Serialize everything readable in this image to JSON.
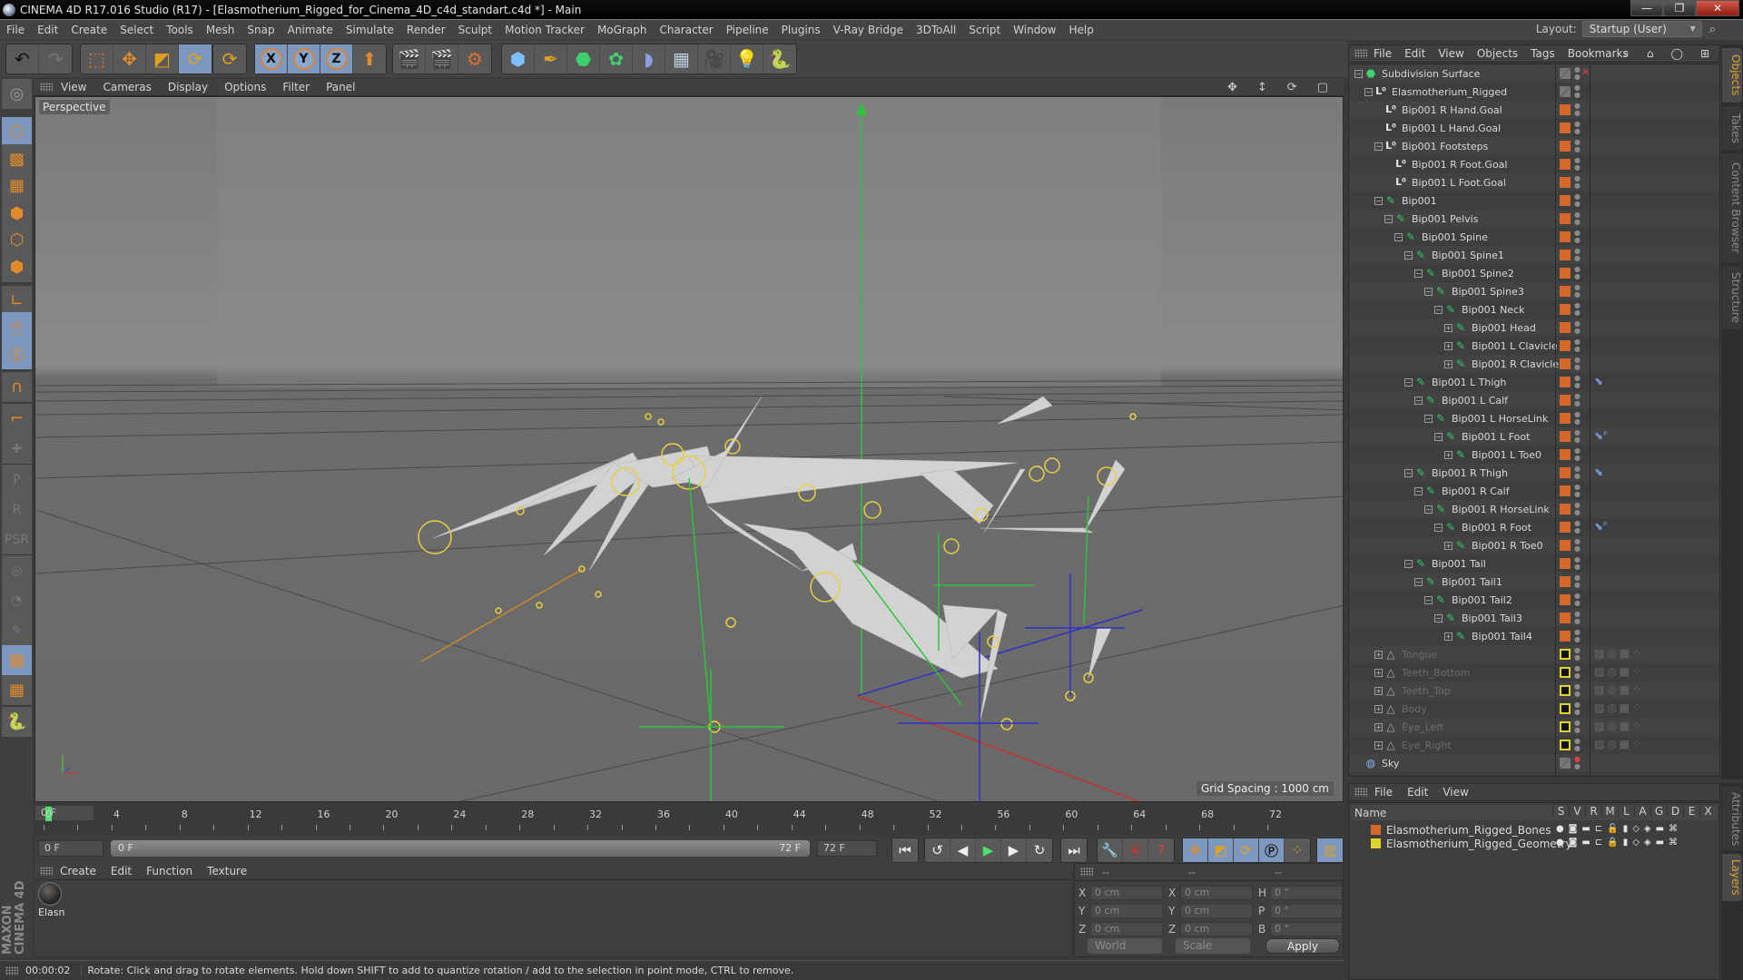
{
  "titlebar": {
    "title": "CINEMA 4D R17.016 Studio (R17) - [Elasmotherium_Rigged_for_Cinema_4D_c4d_standart.c4d *] - Main",
    "buttons": [
      "—",
      "❐",
      "✕"
    ]
  },
  "menubar": {
    "items": [
      "File",
      "Edit",
      "Create",
      "Select",
      "Tools",
      "Mesh",
      "Snap",
      "Animate",
      "Simulate",
      "Render",
      "Sculpt",
      "Motion Tracker",
      "MoGraph",
      "Character",
      "Pipeline",
      "Plugins",
      "V-Ray Bridge",
      "3DToAll",
      "Script",
      "Window",
      "Help"
    ],
    "layout_label": "Layout:",
    "layout_value": "Startup (User)"
  },
  "toolbar": {
    "undo": "↶",
    "redo": "↷",
    "tools": [
      "live-selection",
      "move",
      "scale",
      "rotate",
      "recent-tool"
    ],
    "axes": [
      "X",
      "Y",
      "Z"
    ],
    "coord_system": "world-coordinates",
    "render": [
      "render-view",
      "render-picture-viewer",
      "render-settings"
    ],
    "create": [
      "cube",
      "pen",
      "subdivision",
      "cloner",
      "deformer",
      "floor",
      "camera",
      "light",
      "python"
    ]
  },
  "lefttoolbar": {
    "tools": [
      "make-editable",
      "model-mode",
      "texture-mode",
      "workplane-mode",
      "points-mode",
      "edges-mode",
      "polygons-mode",
      "axis-mode",
      "tweak-mode",
      "solo-mode",
      "snap",
      "workplane-axis",
      "add-joint",
      "pose-p",
      "pose-r",
      "pose-psr",
      "pose-target",
      "pose-camera",
      "pose-edit",
      "lock-workplane",
      "workplane-cycle",
      "python"
    ]
  },
  "viewport": {
    "menu": [
      "View",
      "Cameras",
      "Display",
      "Options",
      "Filter",
      "Panel"
    ],
    "camera_label": "Perspective",
    "grid_spacing": "Grid Spacing : 1000 cm",
    "nav_icons": [
      "✥",
      "↕",
      "⟳",
      "▢"
    ]
  },
  "timeline": {
    "ticks": [
      "0",
      "4",
      "8",
      "12",
      "16",
      "20",
      "24",
      "28",
      "32",
      "36",
      "40",
      "44",
      "48",
      "52",
      "56",
      "60",
      "64",
      "68",
      "72"
    ],
    "current_frame": "0 F",
    "start_field": "0 F",
    "range_start": "0 F",
    "range_end": "72 F",
    "end_field": "72 F"
  },
  "playback": {
    "buttons": [
      "go-to-start",
      "previous-key",
      "previous-frame",
      "play",
      "next-frame",
      "next-key",
      "go-to-end"
    ],
    "glyphs": [
      "⏮",
      "↺",
      "◀",
      "▶",
      "▶",
      "↻",
      "⏭"
    ]
  },
  "materials": {
    "menu": [
      "Create",
      "Edit",
      "Function",
      "Texture"
    ],
    "items": [
      {
        "name": "Elasn"
      }
    ]
  },
  "coordinates": {
    "headers": [
      "--",
      "--",
      "--"
    ],
    "rows": [
      {
        "l1": "X",
        "v1": "0 cm",
        "l2": "X",
        "v2": "0 cm",
        "l3": "H",
        "v3": "0 °"
      },
      {
        "l1": "Y",
        "v1": "0 cm",
        "l2": "Y",
        "v2": "0 cm",
        "l3": "P",
        "v3": "0 °"
      },
      {
        "l1": "Z",
        "v1": "0 cm",
        "l2": "Z",
        "v2": "0 cm",
        "l3": "B",
        "v3": "0 °"
      }
    ],
    "mode": "World",
    "size_mode": "Scale",
    "apply": "Apply"
  },
  "statusbar": {
    "time": "00:00:02",
    "message": "Rotate: Click and drag to rotate elements. Hold down SHIFT to add to quantize rotation / add to the selection in point mode, CTRL to remove."
  },
  "objectmanager": {
    "menu": [
      "File",
      "Edit",
      "View",
      "Objects",
      "Tags",
      "Bookmarks"
    ],
    "objects": [
      {
        "name": "Subdivision Surface",
        "depth": 0,
        "type": "subdiv",
        "exp": "−",
        "layer": "none"
      },
      {
        "name": "Elasmotherium_Rigged",
        "depth": 1,
        "type": "null",
        "exp": "−",
        "layer": "none"
      },
      {
        "name": "Bip001 R Hand.Goal",
        "depth": 2,
        "type": "null",
        "exp": "",
        "layer": "bones"
      },
      {
        "name": "Bip001 L Hand.Goal",
        "depth": 2,
        "type": "null",
        "exp": "",
        "layer": "bones"
      },
      {
        "name": "Bip001 Footsteps",
        "depth": 2,
        "type": "null",
        "exp": "−",
        "layer": "bones"
      },
      {
        "name": "Bip001 R Foot.Goal",
        "depth": 3,
        "type": "null",
        "exp": "",
        "layer": "bones"
      },
      {
        "name": "Bip001 L Foot.Goal",
        "depth": 3,
        "type": "null",
        "exp": "",
        "layer": "bones"
      },
      {
        "name": "Bip001",
        "depth": 2,
        "type": "bone",
        "exp": "−",
        "layer": "bones"
      },
      {
        "name": "Bip001 Pelvis",
        "depth": 3,
        "type": "bone",
        "exp": "−",
        "layer": "bones"
      },
      {
        "name": "Bip001 Spine",
        "depth": 4,
        "type": "bone",
        "exp": "−",
        "layer": "bones"
      },
      {
        "name": "Bip001 Spine1",
        "depth": 5,
        "type": "bone",
        "exp": "−",
        "layer": "bones"
      },
      {
        "name": "Bip001 Spine2",
        "depth": 6,
        "type": "bone",
        "exp": "−",
        "layer": "bones"
      },
      {
        "name": "Bip001 Spine3",
        "depth": 7,
        "type": "bone",
        "exp": "−",
        "layer": "bones"
      },
      {
        "name": "Bip001 Neck",
        "depth": 8,
        "type": "bone",
        "exp": "−",
        "layer": "bones"
      },
      {
        "name": "Bip001 Head",
        "depth": 9,
        "type": "bone",
        "exp": "+",
        "layer": "bones"
      },
      {
        "name": "Bip001 L Clavicle",
        "depth": 9,
        "type": "bone",
        "exp": "+",
        "layer": "bones"
      },
      {
        "name": "Bip001 R Clavicle",
        "depth": 9,
        "type": "bone",
        "exp": "+",
        "layer": "bones"
      },
      {
        "name": "Bip001 L Thigh",
        "depth": 5,
        "type": "bone",
        "exp": "−",
        "layer": "bones",
        "tag": "ik-tag"
      },
      {
        "name": "Bip001 L Calf",
        "depth": 6,
        "type": "bone",
        "exp": "−",
        "layer": "bones"
      },
      {
        "name": "Bip001 L HorseLink",
        "depth": 7,
        "type": "bone",
        "exp": "−",
        "layer": "bones"
      },
      {
        "name": "Bip001 L Foot",
        "depth": 8,
        "type": "bone",
        "exp": "−",
        "layer": "bones",
        "tag": "psr-tag"
      },
      {
        "name": "Bip001 L Toe0",
        "depth": 9,
        "type": "bone",
        "exp": "+",
        "layer": "bones"
      },
      {
        "name": "Bip001 R Thigh",
        "depth": 5,
        "type": "bone",
        "exp": "−",
        "layer": "bones",
        "tag": "ik-tag"
      },
      {
        "name": "Bip001 R Calf",
        "depth": 6,
        "type": "bone",
        "exp": "−",
        "layer": "bones"
      },
      {
        "name": "Bip001 R HorseLink",
        "depth": 7,
        "type": "bone",
        "exp": "−",
        "layer": "bones"
      },
      {
        "name": "Bip001 R Foot",
        "depth": 8,
        "type": "bone",
        "exp": "−",
        "layer": "bones",
        "tag": "psr-tag"
      },
      {
        "name": "Bip001 R Toe0",
        "depth": 9,
        "type": "bone",
        "exp": "+",
        "layer": "bones"
      },
      {
        "name": "Bip001 Tail",
        "depth": 5,
        "type": "bone",
        "exp": "−",
        "layer": "bones"
      },
      {
        "name": "Bip001 Tail1",
        "depth": 6,
        "type": "bone",
        "exp": "−",
        "layer": "bones"
      },
      {
        "name": "Bip001 Tail2",
        "depth": 7,
        "type": "bone",
        "exp": "−",
        "layer": "bones"
      },
      {
        "name": "Bip001 Tail3",
        "depth": 8,
        "type": "bone",
        "exp": "−",
        "layer": "bones"
      },
      {
        "name": "Bip001 Tail4",
        "depth": 9,
        "type": "bone",
        "exp": "+",
        "layer": "bones"
      },
      {
        "name": "Tongue",
        "depth": 2,
        "type": "poly",
        "exp": "+",
        "layer": "geometry",
        "dim": true
      },
      {
        "name": "Teeth_Bottom",
        "depth": 2,
        "type": "poly",
        "exp": "+",
        "layer": "geometry",
        "dim": true
      },
      {
        "name": "Teeth_Top",
        "depth": 2,
        "type": "poly",
        "exp": "+",
        "layer": "geometry",
        "dim": true
      },
      {
        "name": "Body",
        "depth": 2,
        "type": "poly",
        "exp": "+",
        "layer": "geometry",
        "dim": true
      },
      {
        "name": "Eye_Left",
        "depth": 2,
        "type": "poly",
        "exp": "+",
        "layer": "geometry",
        "dim": true
      },
      {
        "name": "Eye_Right",
        "depth": 2,
        "type": "poly",
        "exp": "+",
        "layer": "geometry",
        "dim": true
      },
      {
        "name": "Sky",
        "depth": 0,
        "type": "sky",
        "exp": "",
        "layer": "none"
      }
    ]
  },
  "righttabs": [
    "Objects",
    "Takes",
    "Content Browser",
    "Structure"
  ],
  "layermanager": {
    "menu": [
      "File",
      "Edit",
      "View"
    ],
    "name_header": "Name",
    "columns": [
      "S",
      "V",
      "R",
      "M",
      "L",
      "A",
      "G",
      "D",
      "E",
      "X"
    ],
    "layers": [
      {
        "name": "Elasmotherium_Rigged_Bones",
        "color": "#d4692a"
      },
      {
        "name": "Elasmotherium_Rigged_Geometry",
        "color": "#e0d42a"
      }
    ]
  },
  "bottomtabs": [
    "Attributes",
    "Layers"
  ],
  "colors": {
    "accent_active": "#7d98bf",
    "bone_layer": "#d4692a",
    "geometry_layer": "#e0d42a",
    "tab_active": "#e0a030",
    "playhead": "#4ee06e"
  }
}
